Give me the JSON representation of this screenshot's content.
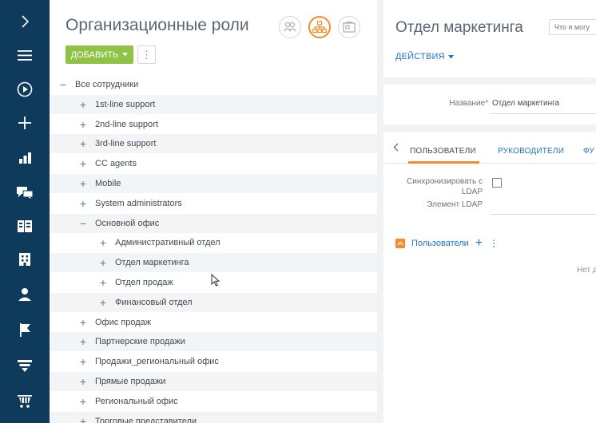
{
  "colors": {
    "nav_bg": "#0e3a5b",
    "accent_orange": "#f68c29",
    "add_button_green": "#8ec345",
    "link_blue": "#1f74c4"
  },
  "nav": {
    "items": [
      {
        "icon": "chevron-right-icon"
      },
      {
        "icon": "menu-icon"
      },
      {
        "icon": "play-icon"
      },
      {
        "icon": "plus-icon"
      },
      {
        "icon": "bar-chart-icon"
      },
      {
        "icon": "chat-icon"
      },
      {
        "icon": "contacts-icon"
      },
      {
        "icon": "building-icon"
      },
      {
        "icon": "user-icon"
      },
      {
        "icon": "flag-icon"
      },
      {
        "icon": "funnel-icon"
      },
      {
        "icon": "cart-icon"
      }
    ]
  },
  "left_panel": {
    "title": "Организационные роли",
    "view_buttons": [
      "users-view-icon",
      "org-chart-view-icon",
      "card-view-icon"
    ],
    "add_label": "ДОБАВИТЬ",
    "more_label": "⋮"
  },
  "tree": [
    {
      "sign": "−",
      "label": "Все сотрудники",
      "level": 0
    },
    {
      "sign": "+",
      "label": "1st-line support",
      "level": 1
    },
    {
      "sign": "+",
      "label": "2nd-line support",
      "level": 1
    },
    {
      "sign": "+",
      "label": "3rd-line support",
      "level": 1
    },
    {
      "sign": "+",
      "label": "CC agents",
      "level": 1
    },
    {
      "sign": "+",
      "label": "Mobile",
      "level": 1
    },
    {
      "sign": "+",
      "label": "System administrators",
      "level": 1
    },
    {
      "sign": "−",
      "label": "Основной офис",
      "level": 1
    },
    {
      "sign": "+",
      "label": "Административный отдел",
      "level": 2
    },
    {
      "sign": "+",
      "label": "Отдел маркетинга",
      "level": 2
    },
    {
      "sign": "+",
      "label": "Отдел продаж",
      "level": 2
    },
    {
      "sign": "+",
      "label": "Финансовый отдел",
      "level": 2
    },
    {
      "sign": "+",
      "label": "Офис продаж",
      "level": 1
    },
    {
      "sign": "+",
      "label": "Партнерские продажи",
      "level": 1
    },
    {
      "sign": "+",
      "label": "Продажи_региональный офис",
      "level": 1
    },
    {
      "sign": "+",
      "label": "Прямые продажи",
      "level": 1
    },
    {
      "sign": "+",
      "label": "Региональный офис",
      "level": 1
    },
    {
      "sign": "+",
      "label": "Торговые представители",
      "level": 1
    }
  ],
  "right_panel": {
    "title": "Отдел маркетинга",
    "search_text": "Что я могу",
    "actions_label": "ДЕЙСТВИЯ",
    "name_label": "Название",
    "name_required_mark": "*",
    "name_value": "Отдел маркетинга",
    "tabs": [
      "ПОЛЬЗОВАТЕЛИ",
      "РУКОВОДИТЕЛИ",
      "ФУ"
    ],
    "sync_label": "Синхронизировать с LDAP",
    "ldap_element_label": "Элемент LDAP",
    "users_section_label": "Пользователи",
    "empty_text": "Нет д"
  }
}
